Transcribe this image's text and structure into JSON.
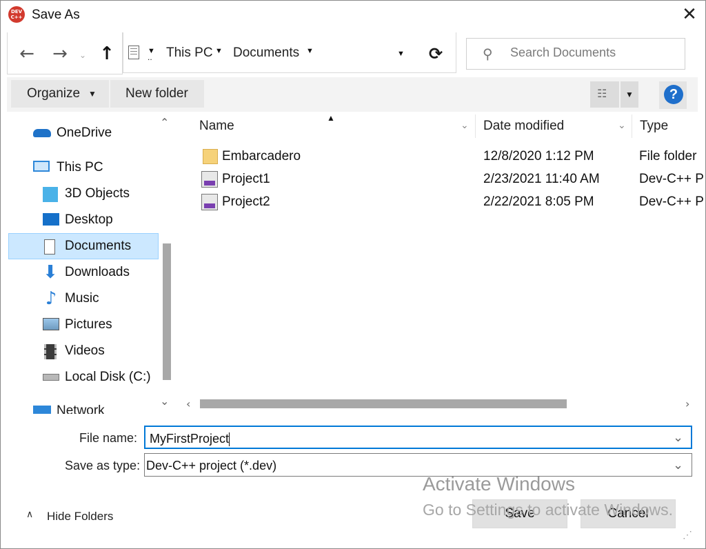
{
  "window": {
    "title": "Save As",
    "app_icon_text": "DEV C++"
  },
  "address": {
    "crumbs": [
      "This PC",
      "Documents"
    ]
  },
  "search": {
    "placeholder": "Search Documents"
  },
  "toolbar": {
    "organize": "Organize",
    "new_folder": "New folder",
    "help": "?"
  },
  "sidebar": {
    "items": [
      {
        "label": "OneDrive"
      },
      {
        "label": "This PC"
      },
      {
        "label": "3D Objects"
      },
      {
        "label": "Desktop"
      },
      {
        "label": "Documents",
        "selected": true
      },
      {
        "label": "Downloads"
      },
      {
        "label": "Music"
      },
      {
        "label": "Pictures"
      },
      {
        "label": "Videos"
      },
      {
        "label": "Local Disk (C:)"
      },
      {
        "label": "Network"
      }
    ]
  },
  "columns": {
    "name": "Name",
    "date": "Date modified",
    "type": "Type"
  },
  "files": [
    {
      "name": "Embarcadero",
      "date": "12/8/2020 1:12 PM",
      "type": "File folder"
    },
    {
      "name": "Project1",
      "date": "2/23/2021 11:40 AM",
      "type": "Dev-C++ P"
    },
    {
      "name": "Project2",
      "date": "2/22/2021 8:05 PM",
      "type": "Dev-C++ P"
    }
  ],
  "form": {
    "file_name_label": "File name:",
    "file_name_value": "MyFirstProject",
    "save_type_label": "Save as type:",
    "save_type_value": "Dev-C++ project (*.dev)"
  },
  "footer": {
    "hide_folders": "Hide Folders",
    "save": "Save",
    "cancel": "Cancel"
  },
  "watermark": {
    "line1": "Activate Windows",
    "line2": "Go to Settings to activate Windows."
  },
  "colors": {
    "accent": "#1f6fcb",
    "selection": "#cce8ff",
    "focus_border": "#0078d7"
  }
}
